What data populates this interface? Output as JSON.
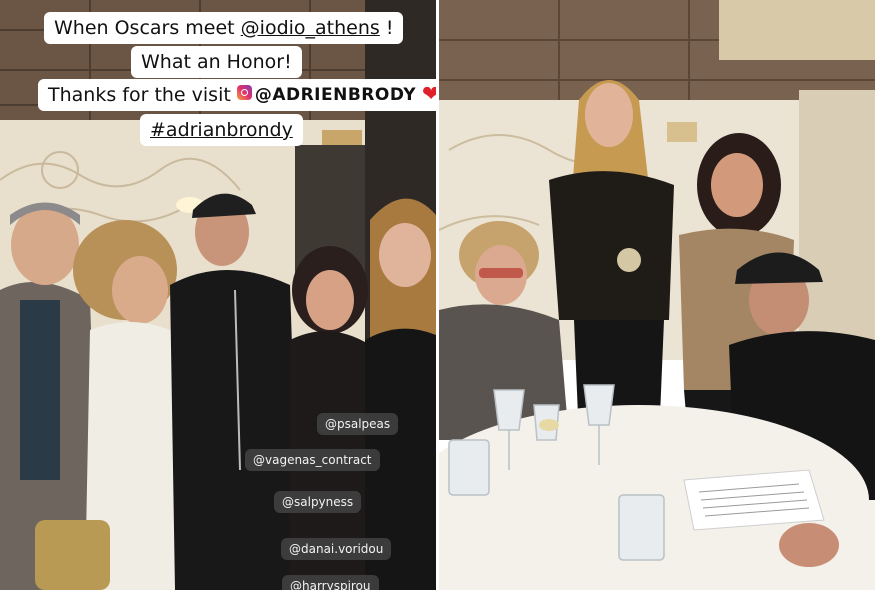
{
  "story": {
    "caption_line1_prefix": "When Oscars meet ",
    "caption_line1_tag": "@iodio_athens",
    "caption_line1_suffix": " !",
    "caption_line2": "What an Honor!",
    "caption_line3_prefix": "Thanks for the visit",
    "caption_line3_mention": "@ADRIENBRODY",
    "caption_line3_icon": "heart-icon",
    "caption_line4": "#adrianbrondy"
  },
  "mention_tags": [
    "@psalpeas",
    "@vagenas_contract",
    "@salpyness",
    "@danai.voridou",
    "@harryspirou"
  ],
  "colors": {
    "heart": "#e0202a",
    "chip_bg": "#464646",
    "caption_bg": "#ffffff"
  }
}
